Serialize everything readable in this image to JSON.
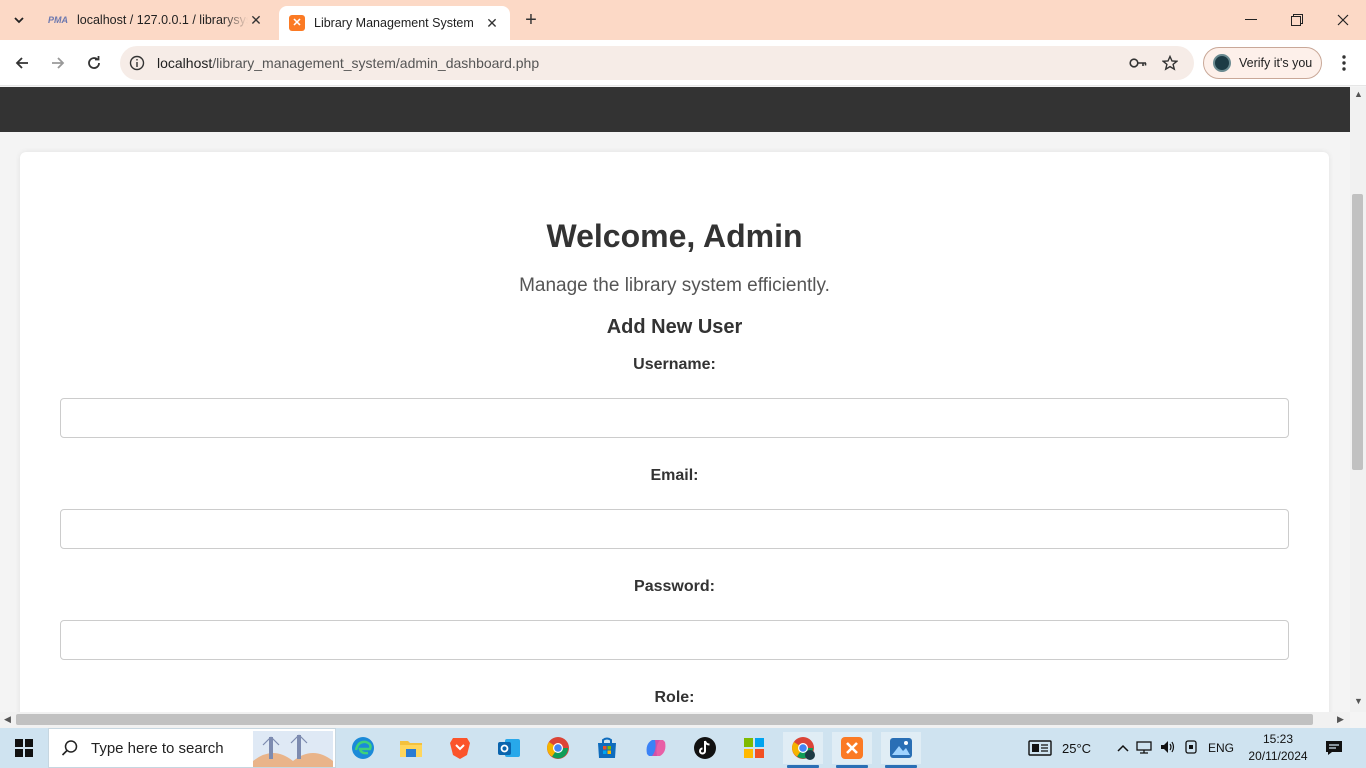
{
  "browser": {
    "tabs": [
      {
        "title": "localhost / 127.0.0.1 / librarysys",
        "icon": "phpmyadmin-icon",
        "active": false
      },
      {
        "title": "Library Management System",
        "icon": "xampp-icon",
        "active": true
      }
    ],
    "url_host": "localhost",
    "url_path": "/library_management_system/admin_dashboard.php",
    "verify_label": "Verify it's you",
    "accent_color": "#fcd9c6"
  },
  "page": {
    "welcome": "Welcome, Admin",
    "subtitle": "Manage the library system efficiently.",
    "section_title": "Add New User",
    "fields": {
      "username_label": "Username:",
      "email_label": "Email:",
      "password_label": "Password:",
      "role_label": "Role:"
    },
    "nav_color": "#333333"
  },
  "taskbar": {
    "search_placeholder": "Type here to search",
    "weather": "25°C",
    "language": "ENG",
    "time": "15:23",
    "date": "20/11/2024",
    "apps": [
      "edge-icon",
      "file-explorer-icon",
      "brave-icon",
      "outlook-icon",
      "chrome-icon",
      "microsoft-store-icon",
      "copilot-icon",
      "tiktok-icon",
      "app-grid-icon",
      "chrome-profile-icon",
      "xampp-icon",
      "photos-icon"
    ]
  }
}
